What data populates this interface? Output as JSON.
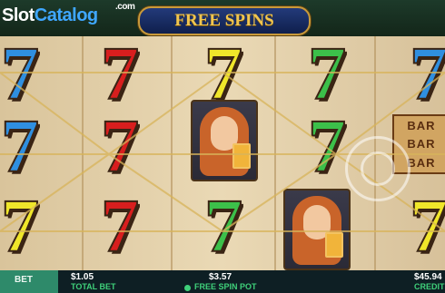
{
  "header": {
    "logo_part1": "Slot",
    "logo_part2": "Catalog",
    "logo_suffix": ".com",
    "title": "FREE SPINS"
  },
  "reels": {
    "grid": [
      [
        "7-blue",
        "7-red",
        "7-yellow",
        "7-green",
        "7-blue"
      ],
      [
        "7-blue",
        "7-red",
        "woman",
        "7-green",
        "bar"
      ],
      [
        "7-yellow",
        "7-red",
        "7-green",
        "woman",
        "7-yellow"
      ]
    ],
    "bar_symbol": {
      "lines": [
        "BAR",
        "BAR",
        "BAR"
      ]
    },
    "seven_glyph": "7",
    "colors": {
      "blue": "#2f8fe0",
      "red": "#d81e1e",
      "yellow": "#f0e62a",
      "green": "#3cc04a"
    }
  },
  "footer": {
    "bet_label": "BET",
    "total_bet_value": "$1.05",
    "total_bet_label": "TOTAL BET",
    "free_spin_pot_value": "$3.57",
    "free_spin_pot_label": "FREE SPIN POT",
    "credits_value": "$45.94",
    "credits_label": "CREDITS"
  }
}
